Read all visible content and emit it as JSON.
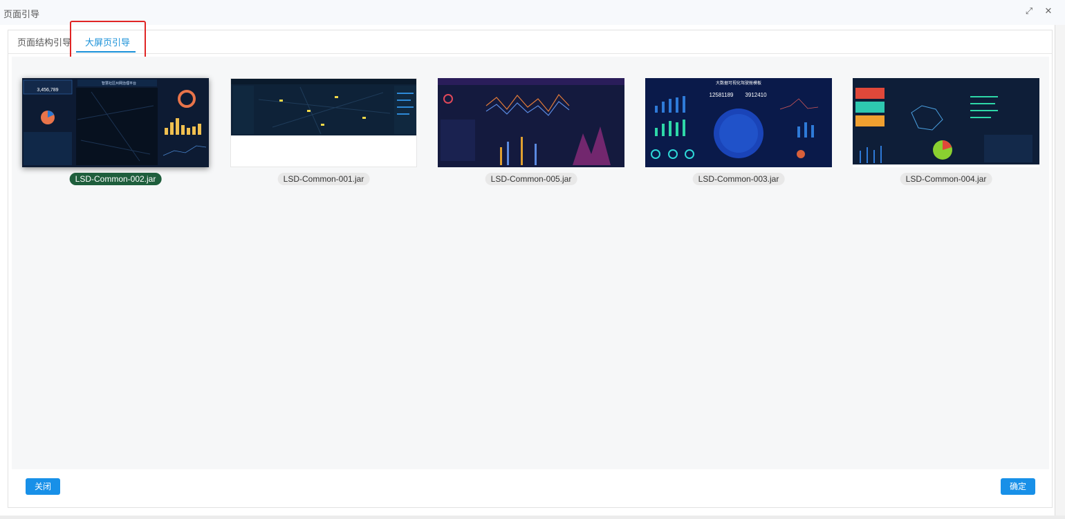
{
  "window": {
    "title": "页面引导"
  },
  "tabs": [
    {
      "label": "页面结构引导",
      "active": false
    },
    {
      "label": "大屏页引导",
      "active": true
    }
  ],
  "cards": [
    {
      "name": "LSD-Common-002.jar",
      "selected": true
    },
    {
      "name": "LSD-Common-001.jar",
      "selected": false
    },
    {
      "name": "LSD-Common-005.jar",
      "selected": false
    },
    {
      "name": "LSD-Common-003.jar",
      "selected": false
    },
    {
      "name": "LSD-Common-004.jar",
      "selected": false
    }
  ],
  "thumbnails": {
    "t1": {
      "title": "智慧社区州网治理平台",
      "stat": "3,456,789"
    },
    "t4": {
      "title": "大数据可视化驾驶舱模板",
      "n1": "12581189",
      "n2": "3912410"
    }
  },
  "footer": {
    "close_label": "关闭",
    "confirm_label": "确定"
  },
  "colors": {
    "accent": "#1890e8",
    "selected_label": "#1e5e3c",
    "highlight": "#e02424"
  },
  "icons": {
    "maximize": "maximize-icon",
    "close": "close-icon"
  }
}
